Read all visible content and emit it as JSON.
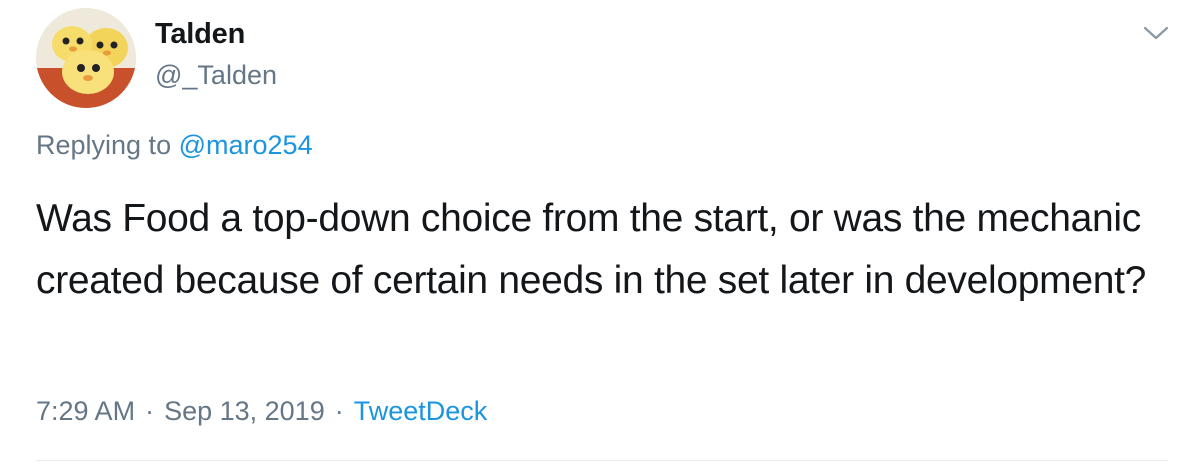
{
  "author": {
    "display_name": "Talden",
    "handle": "@_Talden"
  },
  "reply": {
    "prefix": "Replying to",
    "to_handle": "@maro254"
  },
  "tweet": {
    "text": "Was Food a top-down choice from the start, or was the mechanic created because of certain needs in the set later in development?"
  },
  "meta": {
    "time": "7:29 AM",
    "separator": "·",
    "date": "Sep 13, 2019",
    "source": "TweetDeck"
  },
  "icons": {
    "more_menu": "chevron-down-icon"
  },
  "colors": {
    "link": "#1b95e0",
    "secondary_text": "#657786",
    "primary_text": "#14171a",
    "divider": "#e6ecf0"
  }
}
